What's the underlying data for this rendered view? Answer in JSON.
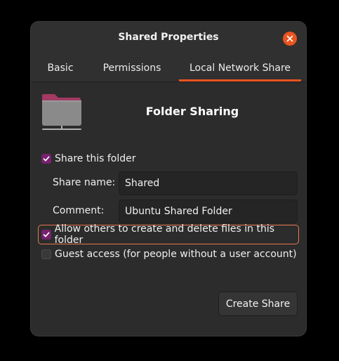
{
  "window": {
    "title": "Shared Properties"
  },
  "tabs": [
    {
      "label": "Basic",
      "active": false
    },
    {
      "label": "Permissions",
      "active": false
    },
    {
      "label": "Local Network Share",
      "active": true
    }
  ],
  "header": {
    "icon": "folder-share-icon",
    "heading": "Folder Sharing"
  },
  "share_folder": {
    "label": "Share this folder",
    "checked": true
  },
  "share_name": {
    "label": "Share name:",
    "value": "Shared"
  },
  "comment": {
    "label": "Comment:",
    "value": "Ubuntu Shared Folder"
  },
  "allow_others": {
    "label": "Allow others to create and delete files in this folder",
    "checked": true
  },
  "guest_access": {
    "label": "Guest access (for people without a user account)",
    "checked": false
  },
  "actions": {
    "create_share_label": "Create Share"
  },
  "colors": {
    "accent": "#e95420",
    "checkbox": "#77216f",
    "window_bg": "#2c2c2c",
    "folder_tab": "#a23a63",
    "folder_body": "#8a8a8a"
  }
}
